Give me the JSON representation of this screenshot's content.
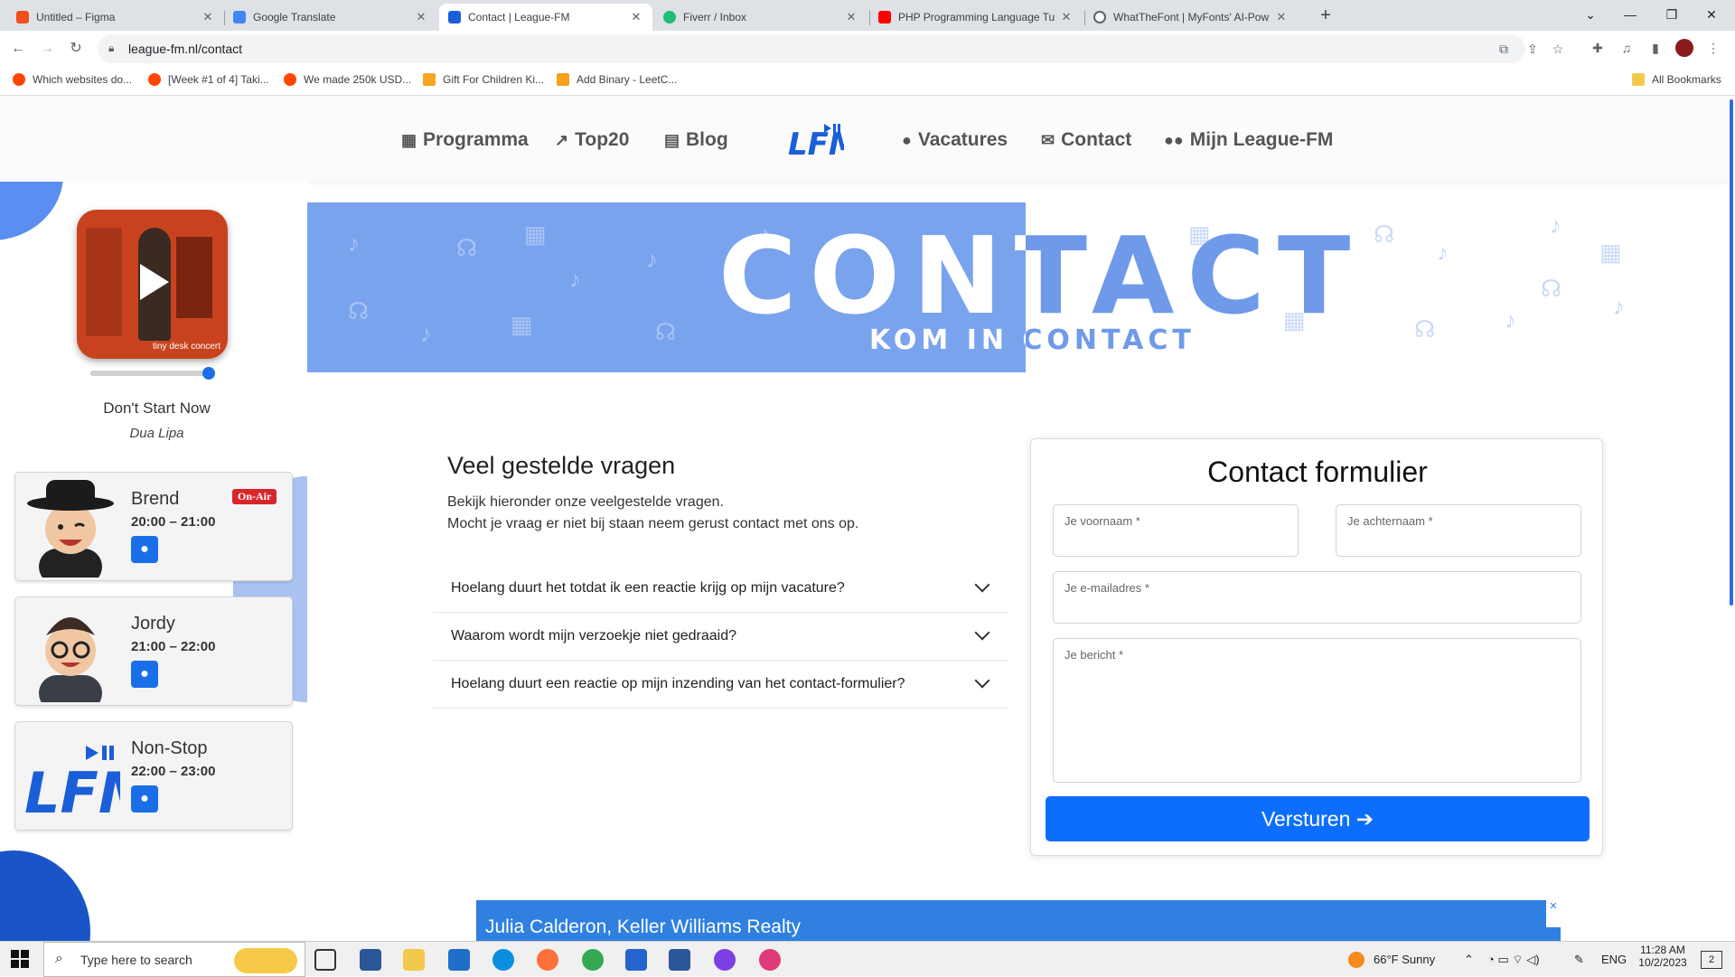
{
  "browser": {
    "tabs": [
      {
        "title": "Untitled – Figma",
        "icon": "figma-icon",
        "color": "#f24e1e"
      },
      {
        "title": "Google Translate",
        "icon": "translate-icon",
        "color": "#4285f4"
      },
      {
        "title": "Contact | League-FM",
        "icon": "leaguefm-icon",
        "color": "#1a5fd8",
        "active": true
      },
      {
        "title": "Fiverr / Inbox",
        "icon": "fiverr-icon",
        "color": "#1dbf73"
      },
      {
        "title": "PHP Programming Language Tu",
        "icon": "youtube-icon",
        "color": "#ff0000"
      },
      {
        "title": "WhatTheFont | MyFonts' AI-Pow",
        "icon": "globe-icon",
        "color": "#5f6368"
      }
    ],
    "url": "league-fm.nl/contact",
    "bookmarks": [
      {
        "label": "Which websites do...",
        "color": "#ff4500"
      },
      {
        "label": "[Week #1 of 4] Taki...",
        "color": "#ff4500"
      },
      {
        "label": "We made 250k USD...",
        "color": "#ff4500"
      },
      {
        "label": "Gift For Children Ki...",
        "color": "#f5a623"
      },
      {
        "label": "Add Binary - LeetC...",
        "color": "#f89f1b"
      }
    ],
    "all_bookmarks": "All Bookmarks"
  },
  "site": {
    "nav": [
      {
        "label": "Programma",
        "icon": "calendar-icon"
      },
      {
        "label": "Top20",
        "icon": "trending-icon"
      },
      {
        "label": "Blog",
        "icon": "blog-icon"
      },
      {
        "label": "Vacatures",
        "icon": "user-icon"
      },
      {
        "label": "Contact",
        "icon": "envelope-icon"
      },
      {
        "label": "Mijn League-FM",
        "icon": "users-icon"
      }
    ],
    "logo_text": "LFM",
    "accent": "#1a6fe8"
  },
  "player": {
    "cover_label": "tiny desk concert",
    "progress": 0.95,
    "title": "Don't Start Now",
    "artist": "Dua Lipa"
  },
  "schedule": [
    {
      "name": "Brend",
      "time": "20:00 – 21:00",
      "badge": "On-Air"
    },
    {
      "name": "Jordy",
      "time": "21:00 – 22:00"
    },
    {
      "name": "Non-Stop",
      "time": "22:00 – 23:00"
    }
  ],
  "banner": {
    "title": "CONTACT",
    "subtitle": "KOM IN CONTACT"
  },
  "faq": {
    "title": "Veel gestelde vragen",
    "intro1": "Bekijk hieronder onze veelgestelde vragen.",
    "intro2": "Mocht je vraag er niet bij staan neem gerust contact met ons op.",
    "items": [
      "Hoelang duurt het totdat ik een reactie krijg op mijn vacature?",
      "Waarom wordt mijn verzoekje niet gedraaid?",
      "Hoelang duurt een reactie op mijn inzending van het contact-formulier?"
    ]
  },
  "form": {
    "title": "Contact formulier",
    "firstname": "Je voornaam *",
    "lastname": "Je achternaam *",
    "email": "Je e-mailadres *",
    "message": "Je bericht *",
    "submit": "Versturen"
  },
  "ad": {
    "text": "Julia Calderon, Keller Williams Realty"
  },
  "taskbar": {
    "search_placeholder": "Type here to search",
    "weather": "66°F  Sunny",
    "lang": "ENG",
    "time": "11:28 AM",
    "date": "10/2/2023",
    "notifications": "2"
  }
}
